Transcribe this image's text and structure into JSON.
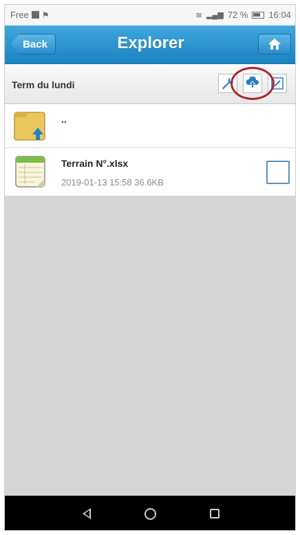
{
  "status_bar": {
    "carrier": "Free",
    "battery_percent": "72 %",
    "time": "16:04"
  },
  "header": {
    "back_label": "Back",
    "title": "Explorer",
    "home_icon": "home-icon"
  },
  "path_bar": {
    "current_folder": "Term du lundi",
    "tools": [
      "wrench-icon",
      "cloud-upload-icon",
      "edit-icon"
    ]
  },
  "files": [
    {
      "name": "..",
      "type": "parent-folder",
      "meta": ""
    },
    {
      "name": "Terrain N°.xlsx",
      "type": "spreadsheet",
      "meta": "2019-01-13 15:58  36.6KB",
      "checked": false
    }
  ],
  "colors": {
    "accent": "#1b84c2",
    "highlight_ring": "#a9262b"
  }
}
